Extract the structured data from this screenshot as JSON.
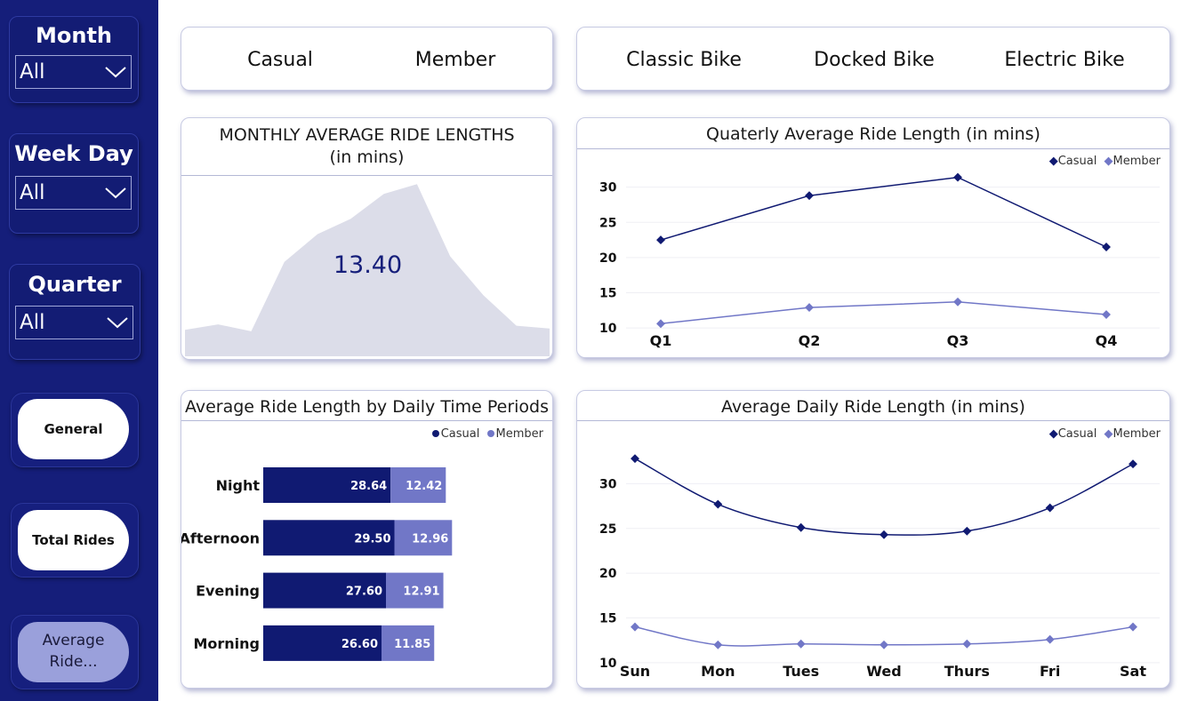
{
  "sidebar": {
    "slicers": [
      {
        "title": "Month",
        "value": "All"
      },
      {
        "title": "Week Day",
        "value": "All"
      },
      {
        "title": "Quarter",
        "value": "All"
      }
    ],
    "nav": [
      {
        "label": "General"
      },
      {
        "label": "Total Rides"
      },
      {
        "label": "Average Ride..."
      }
    ]
  },
  "rider_toggle": {
    "items": [
      "Casual",
      "Member"
    ]
  },
  "bike_toggle": {
    "items": [
      "Classic Bike",
      "Docked Bike",
      "Electric Bike"
    ]
  },
  "monthly": {
    "title": "MONTHLY AVERAGE RIDE LENGTHS",
    "subtitle": "(in mins)",
    "value_label": "13.40",
    "area_color": "#dcdde9"
  },
  "colors": {
    "casual": "#101a72",
    "member": "#7177c7",
    "accent": "#151e7a"
  },
  "legend": {
    "casual": "Casual",
    "member": "Member"
  },
  "chart_data": [
    {
      "type": "area",
      "title": "MONTHLY AVERAGE RIDE LENGTHS (in mins)",
      "values": [
        9.5,
        11.5,
        9.0,
        34.0,
        44.0,
        49.5,
        58.5,
        62.0,
        36.0,
        22.0,
        11.0,
        10.0
      ],
      "ylim": [
        0,
        64
      ],
      "shown_value": "13.40"
    },
    {
      "type": "line",
      "title": "Quaterly Average Ride Length (in mins)",
      "categories": [
        "Q1",
        "Q2",
        "Q3",
        "Q4"
      ],
      "series": [
        {
          "name": "Casual",
          "values": [
            22.5,
            28.8,
            31.4,
            21.5
          ]
        },
        {
          "name": "Member",
          "values": [
            10.6,
            12.9,
            13.7,
            11.9
          ]
        }
      ],
      "yticks": [
        10,
        15,
        20,
        25,
        30
      ],
      "ylim": [
        9,
        34
      ]
    },
    {
      "type": "bar",
      "orientation": "horizontal",
      "stacked": true,
      "title": "Average Ride Length by Daily Time Periods",
      "categories": [
        "Night",
        "Afternoon",
        "Evening",
        "Morning"
      ],
      "series": [
        {
          "name": "Casual",
          "values": [
            28.64,
            29.5,
            27.6,
            26.6
          ],
          "labels": [
            "28.64",
            "29.50",
            "27.60",
            "26.60"
          ]
        },
        {
          "name": "Member",
          "values": [
            12.42,
            12.96,
            12.91,
            11.85
          ],
          "labels": [
            "12.42",
            "12.96",
            "12.91",
            "11.85"
          ]
        }
      ]
    },
    {
      "type": "line",
      "title": "Average Daily Ride Length (in mins)",
      "categories": [
        "Sun",
        "Mon",
        "Tues",
        "Wed",
        "Thurs",
        "Fri",
        "Sat"
      ],
      "series": [
        {
          "name": "Casual",
          "values": [
            32.8,
            27.7,
            25.1,
            24.3,
            24.7,
            27.3,
            32.2
          ]
        },
        {
          "name": "Member",
          "values": [
            14.0,
            12.0,
            12.1,
            12.0,
            12.1,
            12.6,
            14.0
          ]
        }
      ],
      "yticks": [
        10,
        15,
        20,
        25,
        30
      ],
      "ylim": [
        9,
        35
      ]
    }
  ]
}
